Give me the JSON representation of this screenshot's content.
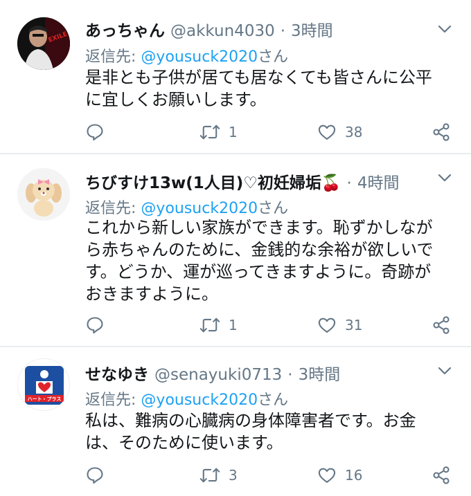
{
  "tweets": [
    {
      "name": "あっちゃん",
      "handle": "@akkun4030",
      "time": "3時間",
      "reply_prefix": "返信先:",
      "reply_to": "@yousuck2020",
      "reply_suffix": "さん",
      "body_lines": [
        "是非とも子供が居ても居なくても皆さんに公平",
        "に宜しくお願いします。"
      ],
      "retweets": "1",
      "likes": "38",
      "avatar_text": "EXILE"
    },
    {
      "name": "ちびすけ13w(1人目)♡初妊婦垢🍒",
      "time": "4時間",
      "reply_prefix": "返信先:",
      "reply_to": "@yousuck2020",
      "reply_suffix": "さん",
      "body_lines": [
        "これから新しい家族ができます。恥ずかしなが",
        "ら赤ちゃんのために、金銭的な余裕が欲しいで",
        "す。どうか、運が巡ってきますように。奇跡が",
        "おきますように。"
      ],
      "retweets": "1",
      "likes": "31"
    },
    {
      "name": "せなゆき",
      "handle": "@senayuki0713",
      "time": "3時間",
      "reply_prefix": "返信先:",
      "reply_to": "@yousuck2020",
      "reply_suffix": "さん",
      "body_lines": [
        "私は、難病の心臓病の身体障害者です。お金",
        "は、そのために使います。"
      ],
      "retweets": "3",
      "likes": "16",
      "avatar_text": "ハート・プラス"
    }
  ],
  "colors": {
    "accent": "#1da1f2",
    "secondary": "#657786",
    "divider": "#e6ecf0"
  },
  "icons": [
    "reply-icon",
    "retweet-icon",
    "like-icon",
    "share-icon",
    "chevron-down-icon"
  ]
}
